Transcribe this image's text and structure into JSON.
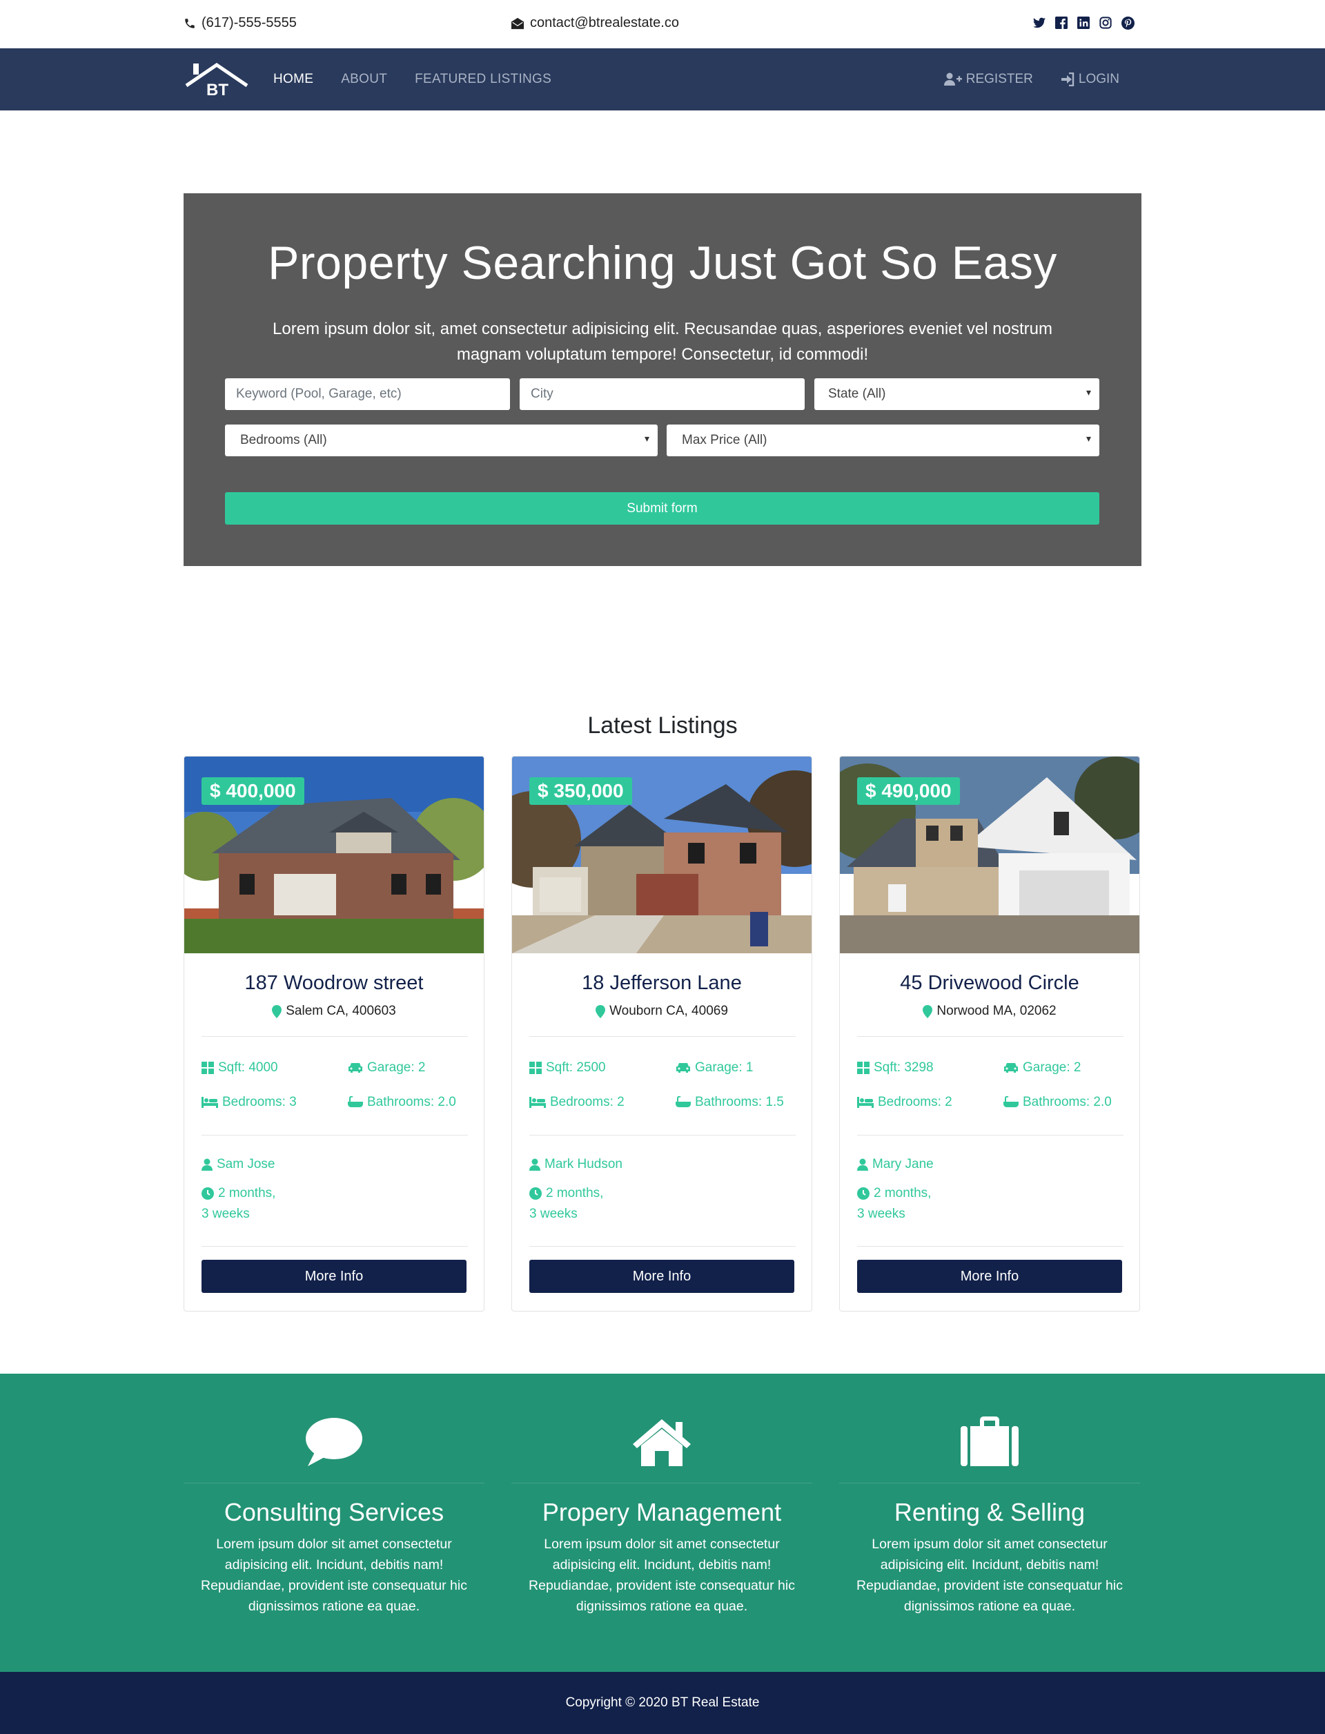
{
  "topbar": {
    "phone": "(617)-555-5555",
    "email": "contact@btrealestate.co",
    "socials": [
      "twitter-icon",
      "facebook-icon",
      "linkedin-icon",
      "instagram-icon",
      "pinterest-icon"
    ]
  },
  "nav": {
    "logo_text": "BT",
    "items": [
      {
        "label": "HOME",
        "active": true
      },
      {
        "label": "ABOUT",
        "active": false
      },
      {
        "label": "FEATURED LISTINGS",
        "active": false
      }
    ],
    "register": "REGISTER",
    "login": "LOGIN"
  },
  "hero": {
    "title": "Property Searching Just Got So Easy",
    "text": "Lorem ipsum dolor sit, amet consectetur adipisicing elit. Recusandae quas, asperiores eveniet vel nostrum magnam voluptatum tempore! Consectetur, id commodi!",
    "keyword_placeholder": "Keyword (Pool, Garage, etc)",
    "city_placeholder": "City",
    "state_select": "State (All)",
    "bedrooms_select": "Bedrooms (All)",
    "maxprice_select": "Max Price (All)",
    "submit": "Submit form"
  },
  "latest": {
    "title": "Latest Listings",
    "listings": [
      {
        "price": "$ 400,000",
        "title": "187 Woodrow street",
        "location": "Salem CA, 400603",
        "sqft": "Sqft: 4000",
        "garage": "Garage: 2",
        "bedrooms": "Bedrooms: 3",
        "bathrooms": "Bathrooms: 2.0",
        "agent": "Sam Jose",
        "time1": "2 months,",
        "time2": "3 weeks",
        "button": "More Info"
      },
      {
        "price": "$ 350,000",
        "title": "18 Jefferson Lane",
        "location": "Wouborn CA, 40069",
        "sqft": "Sqft: 2500",
        "garage": "Garage: 1",
        "bedrooms": "Bedrooms: 2",
        "bathrooms": "Bathrooms: 1.5",
        "agent": "Mark Hudson",
        "time1": "2 months,",
        "time2": "3 weeks",
        "button": "More Info"
      },
      {
        "price": "$ 490,000",
        "title": "45 Drivewood Circle",
        "location": "Norwood MA, 02062",
        "sqft": "Sqft: 3298",
        "garage": "Garage: 2",
        "bedrooms": "Bedrooms: 2",
        "bathrooms": "Bathrooms: 2.0",
        "agent": "Mary Jane",
        "time1": "2 months,",
        "time2": "3 weeks",
        "button": "More Info"
      }
    ]
  },
  "services": [
    {
      "icon": "comment-icon",
      "title": "Consulting Services",
      "text": "Lorem ipsum dolor sit amet consectetur adipisicing elit. Incidunt, debitis nam! Repudiandae, provident iste consequatur hic dignissimos ratione ea quae."
    },
    {
      "icon": "home-icon",
      "title": "Propery Management",
      "text": "Lorem ipsum dolor sit amet consectetur adipisicing elit. Incidunt, debitis nam! Repudiandae, provident iste consequatur hic dignissimos ratione ea quae."
    },
    {
      "icon": "suitcase-icon",
      "title": "Renting & Selling",
      "text": "Lorem ipsum dolor sit amet consectetur adipisicing elit. Incidunt, debitis nam! Repudiandae, provident iste consequatur hic dignissimos ratione ea quae."
    }
  ],
  "footer": {
    "copyright": "Copyright © 2020 BT Real Estate"
  },
  "colors": {
    "nav": "#2a3a5c",
    "accent": "#30c89b",
    "dark": "#12214a",
    "services_bg": "#239375",
    "hero_bg": "#5a5a5a"
  }
}
